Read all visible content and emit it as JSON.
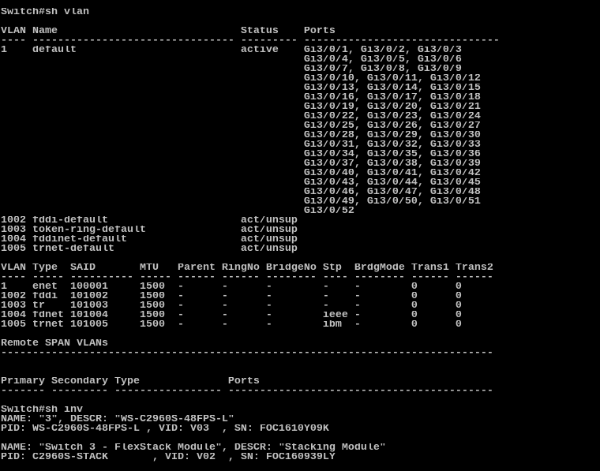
{
  "terminal": {
    "colors": {
      "background": "#000000",
      "foreground": "#c0c0c0"
    },
    "lines": [
      "Switch#sh vlan",
      "",
      "VLAN Name                             Status    Ports",
      "---- -------------------------------- --------- -------------------------------",
      "1    default                          active    Gi3/0/1, Gi3/0/2, Gi3/0/3",
      "                                                Gi3/0/4, Gi3/0/5, Gi3/0/6",
      "                                                Gi3/0/7, Gi3/0/8, Gi3/0/9",
      "                                                Gi3/0/10, Gi3/0/11, Gi3/0/12",
      "                                                Gi3/0/13, Gi3/0/14, Gi3/0/15",
      "                                                Gi3/0/16, Gi3/0/17, Gi3/0/18",
      "                                                Gi3/0/19, Gi3/0/20, Gi3/0/21",
      "                                                Gi3/0/22, Gi3/0/23, Gi3/0/24",
      "                                                Gi3/0/25, Gi3/0/26, Gi3/0/27",
      "                                                Gi3/0/28, Gi3/0/29, Gi3/0/30",
      "                                                Gi3/0/31, Gi3/0/32, Gi3/0/33",
      "                                                Gi3/0/34, Gi3/0/35, Gi3/0/36",
      "                                                Gi3/0/37, Gi3/0/38, Gi3/0/39",
      "                                                Gi3/0/40, Gi3/0/41, Gi3/0/42",
      "                                                Gi3/0/43, Gi3/0/44, Gi3/0/45",
      "                                                Gi3/0/46, Gi3/0/47, Gi3/0/48",
      "                                                Gi3/0/49, Gi3/0/50, Gi3/0/51",
      "                                                Gi3/0/52",
      "1002 fddi-default                     act/unsup",
      "1003 token-ring-default               act/unsup",
      "1004 fddinet-default                  act/unsup",
      "1005 trnet-default                    act/unsup",
      "",
      "VLAN Type  SAID       MTU   Parent RingNo BridgeNo Stp  BrdgMode Trans1 Trans2",
      "---- ----- ---------- ----- ------ ------ -------- ---- -------- ------ ------",
      "1    enet  100001     1500  -      -      -        -    -        0      0",
      "1002 fddi  101002     1500  -      -      -        -    -        0      0",
      "1003 tr    101003     1500  -      -      -        -    -        0      0",
      "1004 fdnet 101004     1500  -      -      -        ieee -        0      0",
      "1005 trnet 101005     1500  -      -      -        ibm  -        0      0",
      "",
      "Remote SPAN VLANs",
      "------------------------------------------------------------------------------",
      "",
      "",
      "Primary Secondary Type              Ports",
      "------- --------- ----------------- ------------------------------------------",
      "",
      "Switch#sh inv",
      "NAME: \"3\", DESCR: \"WS-C2960S-48FPS-L\"",
      "PID: WS-C2960S-48FPS-L , VID: V03  , SN: FOC1610Y09K",
      "",
      "NAME: \"Switch 3 - FlexStack Module\", DESCR: \"Stacking Module\"",
      "PID: C2960S-STACK       , VID: V02  , SN: FOC160939LY"
    ]
  }
}
